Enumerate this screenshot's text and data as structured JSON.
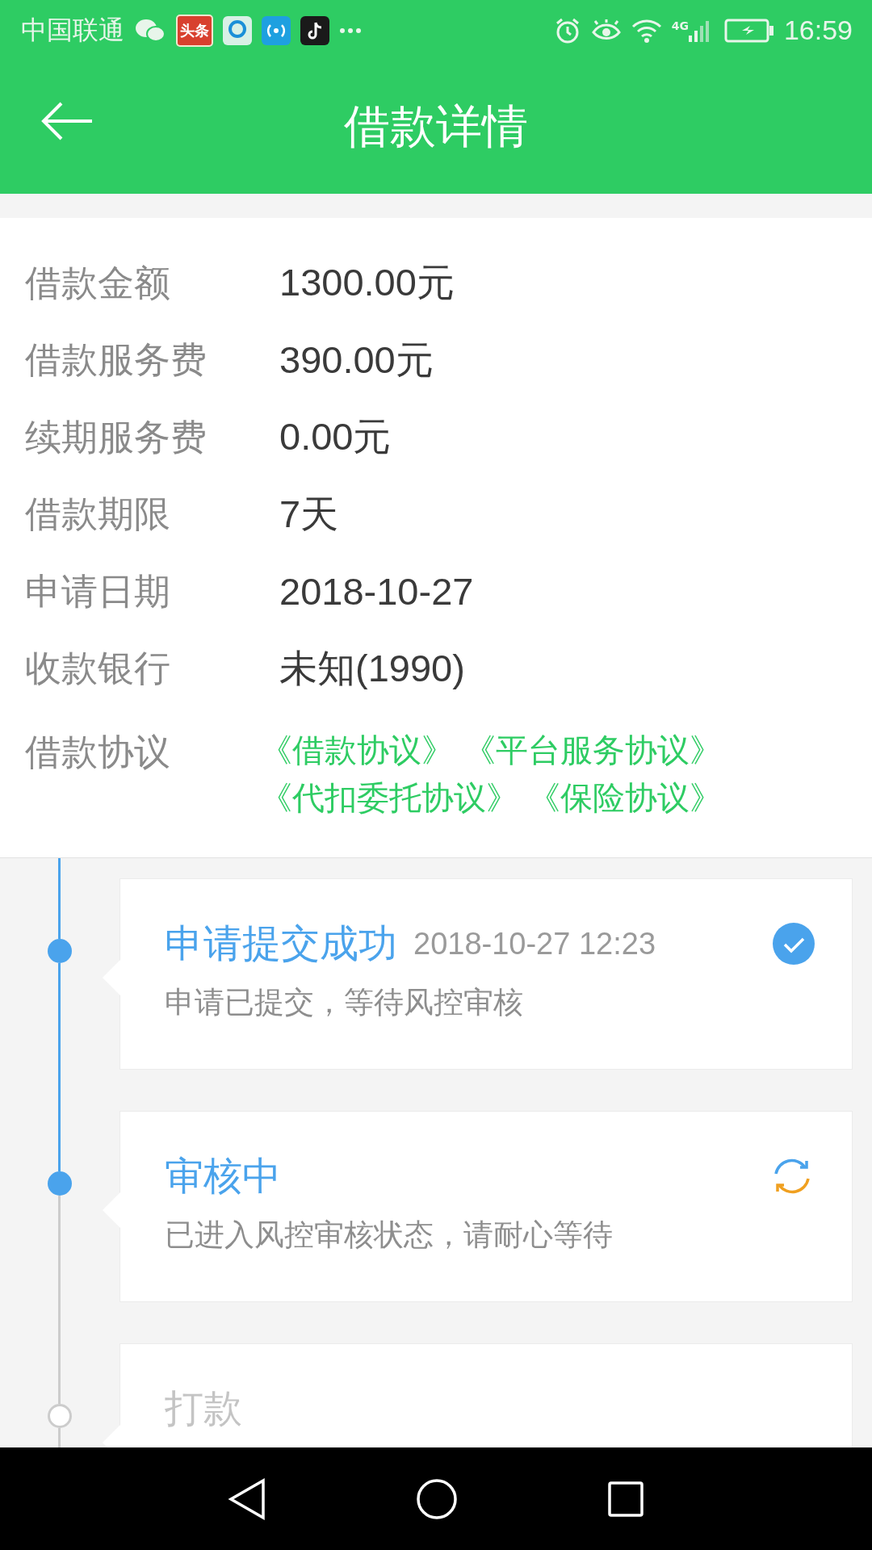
{
  "status_bar": {
    "carrier": "中国联通",
    "app_badge": "头条",
    "network": "4G",
    "time": "16:59"
  },
  "header": {
    "title": "借款详情"
  },
  "details": [
    {
      "label": "借款金额",
      "value": "1300.00元"
    },
    {
      "label": "借款服务费",
      "value": "390.00元"
    },
    {
      "label": "续期服务费",
      "value": "0.00元"
    },
    {
      "label": "借款期限",
      "value": "7天"
    },
    {
      "label": "申请日期",
      "value": "2018-10-27"
    },
    {
      "label": "收款银行",
      "value": "未知(1990)"
    }
  ],
  "agreements": {
    "label": "借款协议",
    "links": [
      "《借款协议》",
      "《平台服务协议》",
      "《代扣委托协议》",
      "《保险协议》"
    ]
  },
  "timeline": [
    {
      "title": "申请提交成功",
      "time": "2018-10-27 12:23",
      "description": "申请已提交，等待风控审核",
      "kind": "done"
    },
    {
      "title": "审核中",
      "description": "已进入风控审核状态，请耐心等待",
      "kind": "processing"
    },
    {
      "title": "打款",
      "kind": "pending"
    }
  ]
}
